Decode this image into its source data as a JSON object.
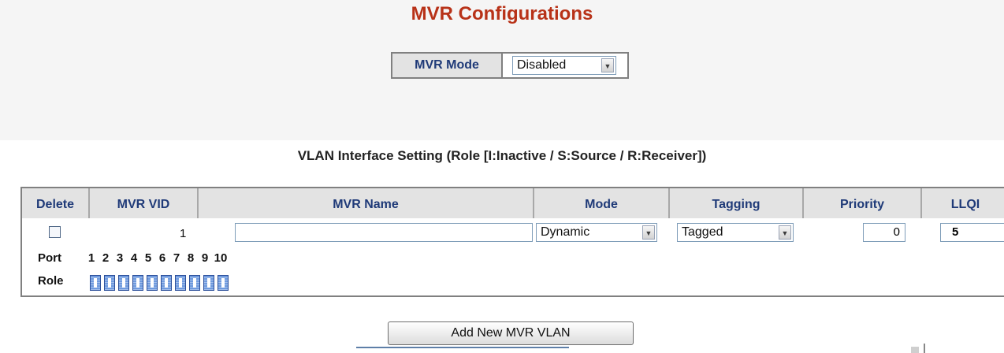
{
  "page": {
    "title": "MVR Configurations",
    "subtitle": "VLAN Interface Setting (Role [I:Inactive / S:Source / R:Receiver])"
  },
  "mvr_mode": {
    "label": "MVR Mode",
    "value": "Disabled"
  },
  "table": {
    "headers": {
      "delete": "Delete",
      "vid": "MVR VID",
      "name": "MVR Name",
      "mode": "Mode",
      "tagging": "Tagging",
      "priority": "Priority",
      "llqi": "LLQI"
    },
    "row": {
      "delete_checked": false,
      "vid": "1",
      "name": "",
      "mode": "Dynamic",
      "tagging": "Tagged",
      "priority": "0",
      "llqi": "5"
    },
    "port_label": "Port",
    "role_label": "Role",
    "ports": [
      "1",
      "2",
      "3",
      "4",
      "5",
      "6",
      "7",
      "8",
      "9",
      "10"
    ],
    "roles": [
      "I",
      "I",
      "I",
      "I",
      "I",
      "I",
      "I",
      "I",
      "I",
      "I"
    ]
  },
  "actions": {
    "add_button": "Add New MVR VLAN"
  },
  "colors": {
    "title": "#b83218",
    "header_text": "#1f3a78",
    "header_bg": "#e3e3e3",
    "role_button": "#6f9ade"
  }
}
